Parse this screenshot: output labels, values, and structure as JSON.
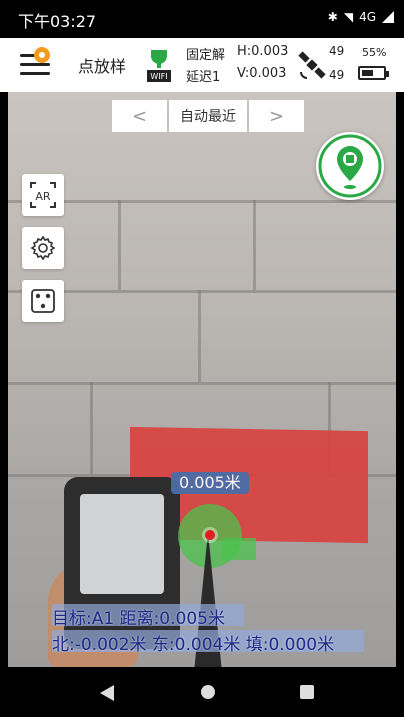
{
  "status_bar": {
    "time": "下午03:27",
    "network": "4G",
    "icons": [
      "bluetooth-icon",
      "wifi-icon",
      "signal-icon"
    ]
  },
  "app_bar": {
    "title": "点放样",
    "gnss": {
      "fix_status": "固定解",
      "delay": "延迟1",
      "h_precision": "H:0.003",
      "v_precision": "V:0.003",
      "wifi_label": "WIFI"
    },
    "satellites": {
      "used": "49",
      "tracked": "49"
    },
    "battery": {
      "percent": "55%",
      "level": 0.55
    }
  },
  "nav_controls": {
    "prev": "<",
    "center": "自动最近",
    "next": ">"
  },
  "side_tools": [
    {
      "label": "AR",
      "icon": "ar-icon"
    },
    {
      "label": "",
      "icon": "gear-icon"
    },
    {
      "label": "",
      "icon": "dice-icon"
    }
  ],
  "overlay": {
    "distance_tag": "0.005米",
    "target_line": "目标:A1 距离:0.005米",
    "offset_line": "北:-0.002米 东:0.004米 填:0.000米"
  },
  "colors": {
    "accent_green": "#2aa845",
    "info_text": "#1d2a8a",
    "tag_blue": "#4a6ea8"
  }
}
